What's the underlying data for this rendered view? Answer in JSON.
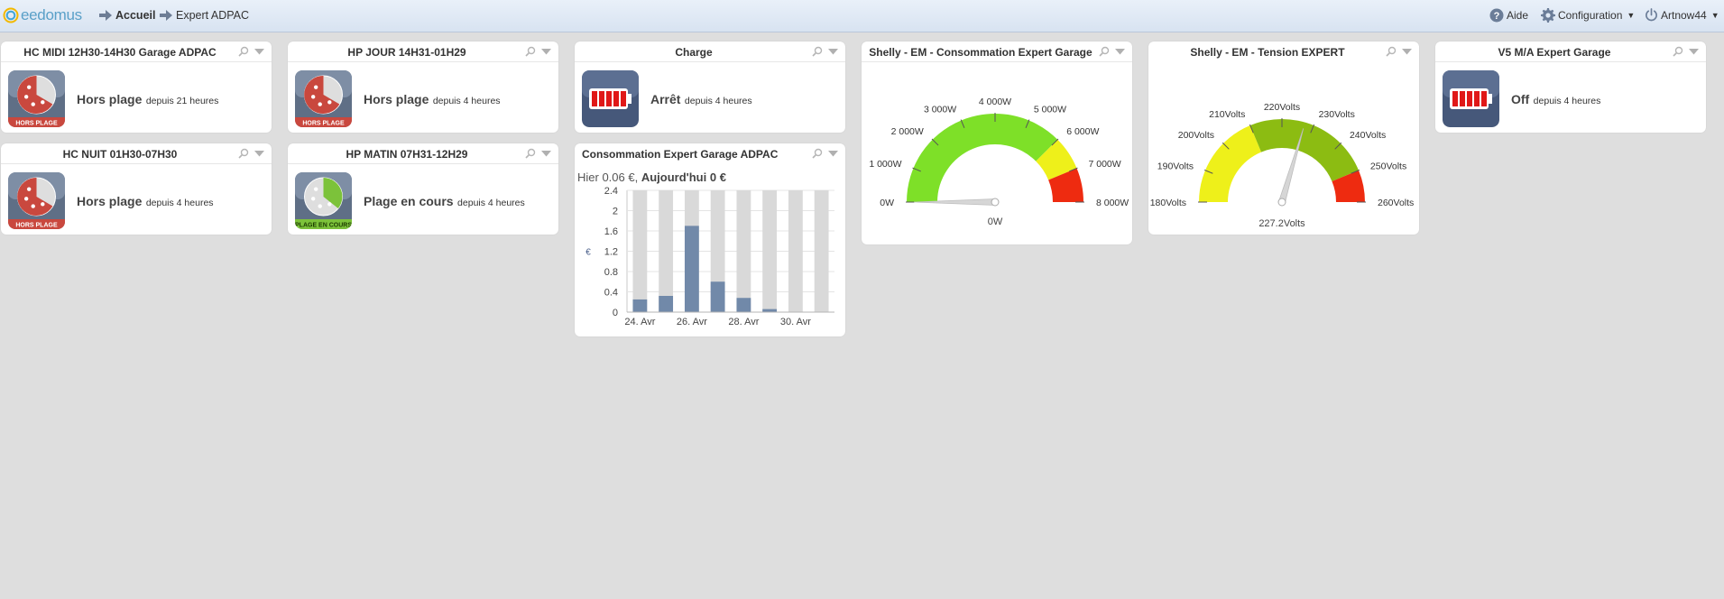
{
  "header": {
    "logo": "eedomus",
    "breadcrumb": [
      "Accueil",
      "Expert ADPAC"
    ],
    "help_label": "Aide",
    "config_label": "Configuration",
    "user_label": "Artnow44"
  },
  "widgets": [
    {
      "title": "HC MIDI 12H30-14H30 Garage ADPAC",
      "icon": "clock-off-plage-icon",
      "icon_caption": "HORS PLAGE",
      "state": "Hors plage",
      "since": "depuis 21 heures"
    },
    {
      "title": "HP JOUR 14H31-01H29",
      "icon": "clock-off-plage-icon",
      "icon_caption": "HORS PLAGE",
      "state": "Hors plage",
      "since": "depuis 4 heures"
    },
    {
      "title": "Charge",
      "icon": "battery-icon",
      "state": "Arrêt",
      "since": "depuis 4 heures"
    },
    {
      "title": "V5 M/A Expert Garage",
      "icon": "battery-icon",
      "state": "Off",
      "since": "depuis 4 heures"
    },
    {
      "title": "HC NUIT 01H30-07H30",
      "icon": "clock-off-plage-icon",
      "icon_caption": "HORS PLAGE",
      "state": "Hors plage",
      "since": "depuis 4 heures"
    },
    {
      "title": "HP MATIN 07H31-12H29",
      "icon": "clock-en-cours-icon",
      "icon_caption": "PLAGE EN COURS",
      "state": "Plage en cours",
      "since": "depuis 4 heures"
    }
  ],
  "consumption": {
    "title": "Consommation Expert Garage ADPAC",
    "hier": "Hier 0.06 €,",
    "aujourdhui": "Aujourd'hui 0 €",
    "y_unit_label": "€",
    "chart_data": {
      "type": "bar",
      "categories": [
        "24. Avr",
        "25. Avr",
        "26. Avr",
        "27. Avr",
        "28. Avr",
        "29. Avr",
        "30. Avr",
        "1. Mai"
      ],
      "x_tick_labels": [
        "24. Avr",
        "26. Avr",
        "28. Avr",
        "30. Avr"
      ],
      "y_ticks": [
        "0",
        "0.4",
        "0.8",
        "1.2",
        "1.6",
        "2",
        "2.4"
      ],
      "ylim": [
        0,
        2.4
      ],
      "series": [
        {
          "values": [
            0.25,
            0.32,
            1.7,
            0.6,
            0.28,
            0.06,
            0
          ]
        }
      ],
      "bg_bar_color": "#d9d9d9",
      "bar_color": "#7189a9"
    }
  },
  "power_gauge": {
    "title": "Shelly - EM - Consommation Expert Garage",
    "value_label": "0W",
    "chart_data": {
      "type": "gauge",
      "min": 0,
      "max": 8000,
      "value": 0,
      "tick_labels": [
        "0W",
        "1 000W",
        "2 000W",
        "3 000W",
        "4 000W",
        "5 000W",
        "6 000W",
        "7 000W",
        "8 000W"
      ],
      "bands": [
        {
          "from": 0,
          "to": 6000,
          "color": "#7ee028"
        },
        {
          "from": 6000,
          "to": 7000,
          "color": "#eef01a"
        },
        {
          "from": 7000,
          "to": 8000,
          "color": "#ee2b10"
        }
      ]
    }
  },
  "voltage_gauge": {
    "title": "Shelly - EM - Tension EXPERT",
    "value_label": "227.2Volts",
    "chart_data": {
      "type": "gauge",
      "min": 180,
      "max": 260,
      "value": 227.2,
      "tick_labels": [
        "180Volts",
        "190Volts",
        "200Volts",
        "210Volts",
        "220Volts",
        "230Volts",
        "240Volts",
        "250Volts",
        "260Volts"
      ],
      "bands": [
        {
          "from": 180,
          "to": 210,
          "color": "#eef01a"
        },
        {
          "from": 210,
          "to": 250,
          "color": "#8cbc12"
        },
        {
          "from": 250,
          "to": 260,
          "color": "#ee2b10"
        }
      ]
    }
  }
}
